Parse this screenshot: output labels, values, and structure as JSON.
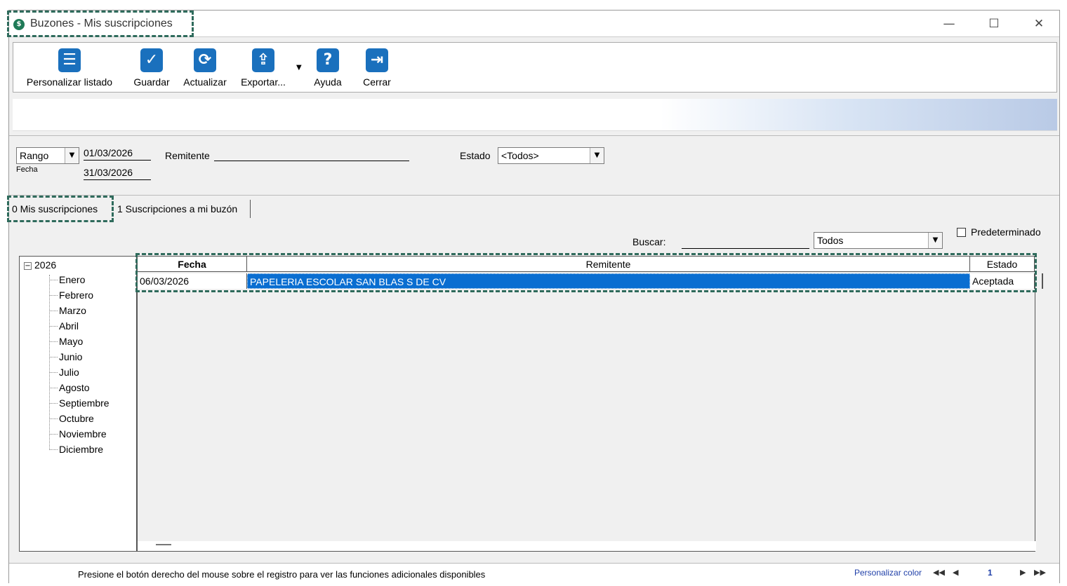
{
  "window": {
    "title": "Buzones - Mis suscripciones",
    "app_icon": "$",
    "controls": {
      "minimize": "—",
      "maximize": "☐",
      "close": "✕"
    }
  },
  "toolbar": {
    "buttons": [
      {
        "label": "Personalizar listado",
        "icon": "list-settings-icon",
        "glyph": "☰"
      },
      {
        "label": "Guardar",
        "icon": "checkbox-save-icon",
        "glyph": "✓"
      },
      {
        "label": "Actualizar",
        "icon": "refresh-icon",
        "glyph": "⟳"
      },
      {
        "label": "Exportar...",
        "icon": "export-icon",
        "glyph": "⇪"
      },
      {
        "label": "Ayuda",
        "icon": "help-icon",
        "glyph": "?"
      },
      {
        "label": "Cerrar",
        "icon": "exit-icon",
        "glyph": "⇥"
      }
    ],
    "export_arrow": "▼"
  },
  "filters": {
    "range_select": "Rango",
    "fecha_label": "Fecha",
    "date_from": "01/03/2026",
    "date_to": "31/03/2026",
    "remitente_label": "Remitente",
    "remitente_value": "",
    "estado_label": "Estado",
    "estado_value": "<Todos>"
  },
  "tabs": [
    {
      "label": "0 Mis suscripciones",
      "active": true
    },
    {
      "label": "1 Suscripciones a mi buzón",
      "active": false
    }
  ],
  "search": {
    "label": "Buscar:",
    "value": "",
    "scope": "Todos",
    "default_checkbox_label": "Predeterminado",
    "default_checked": false
  },
  "tree": {
    "year": "2026",
    "expander": "−",
    "months": [
      "Enero",
      "Febrero",
      "Marzo",
      "Abril",
      "Mayo",
      "Junio",
      "Julio",
      "Agosto",
      "Septiembre",
      "Octubre",
      "Noviembre",
      "Diciembre"
    ]
  },
  "grid": {
    "columns": [
      "Fecha",
      "Remitente",
      "Estado"
    ],
    "rows": [
      {
        "fecha": "06/03/2026",
        "remitente": "PAPELERIA ESCOLAR SAN BLAS S DE CV",
        "estado": "Aceptada"
      }
    ]
  },
  "status": {
    "message": "Presione el botón derecho del mouse sobre el registro para ver las funciones adicionales disponibles",
    "personalizar_color": "Personalizar color",
    "page": "1",
    "first": "◀◀",
    "prev": "◀",
    "next": "▶",
    "last": "▶▶"
  },
  "colors": {
    "accent": "#1a70bd",
    "selection": "#0a6ed1",
    "highlight_border": "#2f6b5c"
  }
}
